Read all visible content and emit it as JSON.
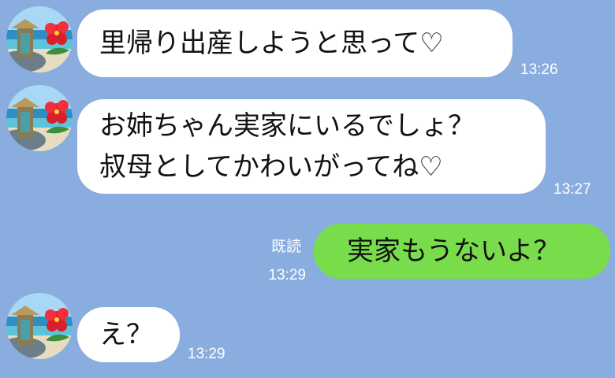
{
  "colors": {
    "background": "#8aaddf",
    "incoming_bubble": "#ffffff",
    "outgoing_bubble": "#79dc4b",
    "meta_text": "#ffffff"
  },
  "messages": [
    {
      "sender": "other",
      "avatar": "beach-avatar-icon",
      "lines": [
        "里帰り出産しようと思って♡"
      ],
      "time": "13:26"
    },
    {
      "sender": "other",
      "avatar": "beach-avatar-icon",
      "lines": [
        "お姉ちゃん実家にいるでしょ？",
        "叔母としてかわいがってね♡"
      ],
      "time": "13:27"
    },
    {
      "sender": "me",
      "read_label": "既読",
      "lines": [
        "実家もうないよ？"
      ],
      "time": "13:29"
    },
    {
      "sender": "other",
      "avatar": "beach-avatar-icon",
      "lines": [
        "え？"
      ],
      "time": "13:29"
    }
  ]
}
